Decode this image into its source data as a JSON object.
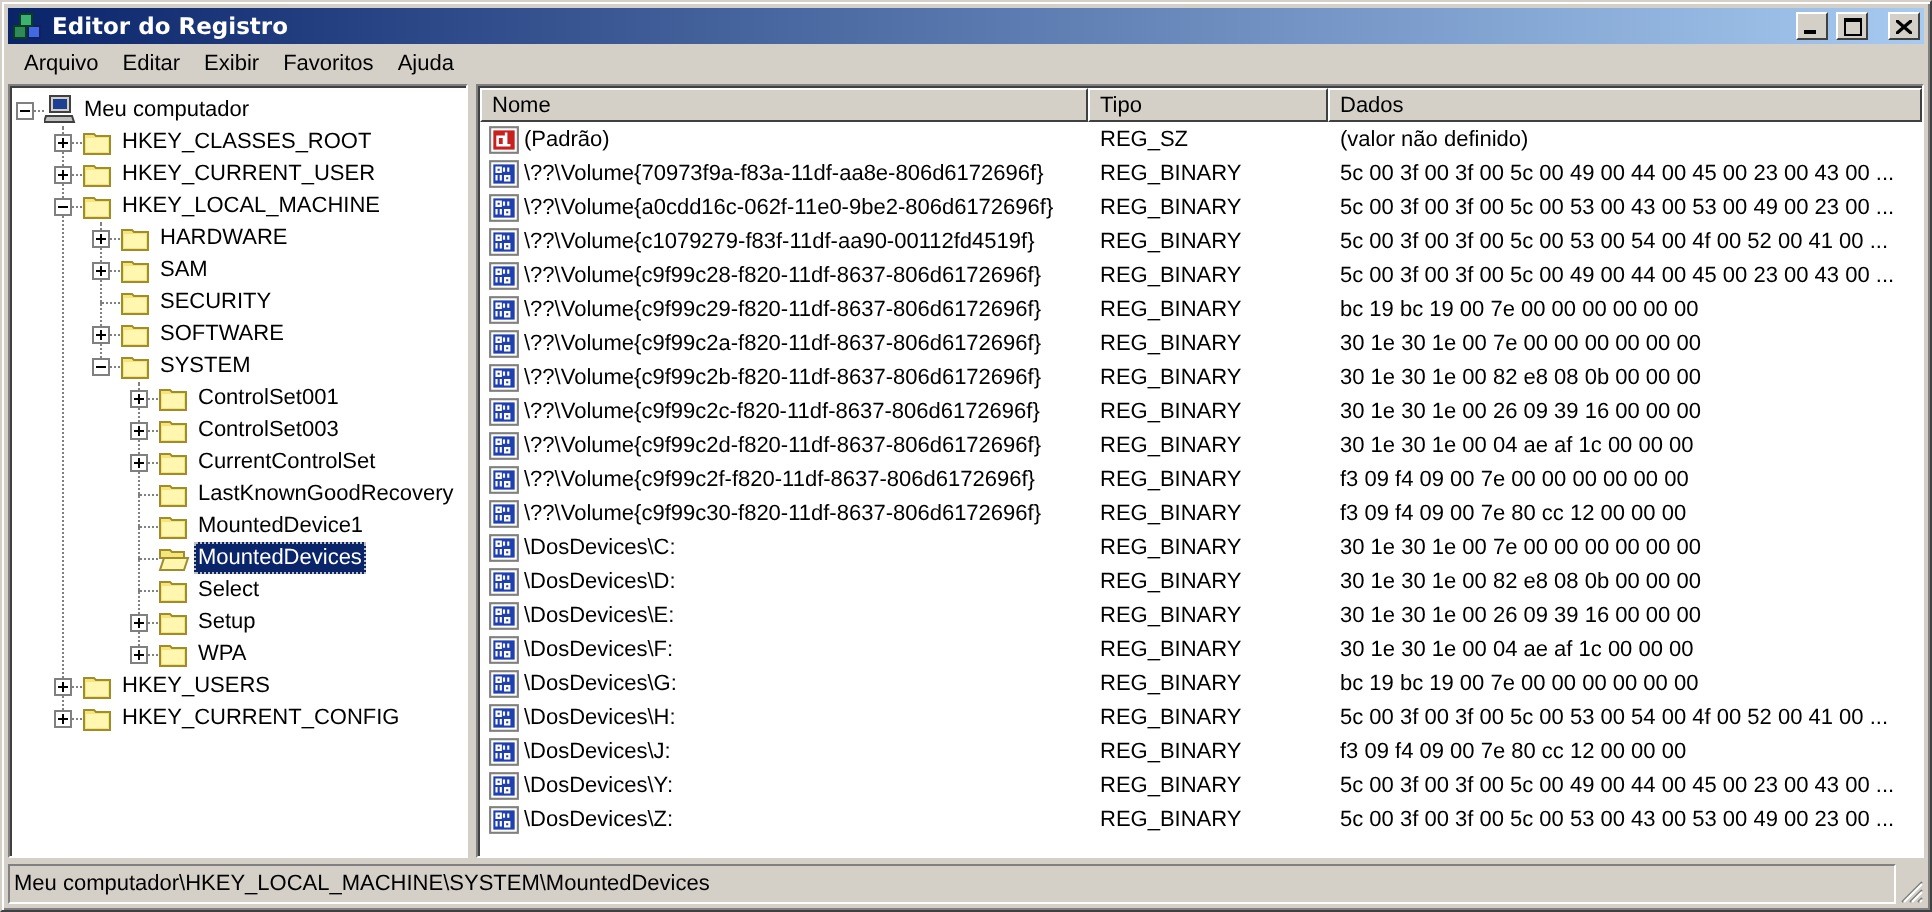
{
  "window": {
    "title": "Editor do Registro"
  },
  "menu": [
    "Arquivo",
    "Editar",
    "Exibir",
    "Favoritos",
    "Ajuda"
  ],
  "tree": {
    "root": {
      "label": "Meu computador",
      "expandable": true,
      "selected": false,
      "children": [
        {
          "label": "HKEY_CLASSES_ROOT",
          "expandable": true,
          "selected": false
        },
        {
          "label": "HKEY_CURRENT_USER",
          "expandable": true,
          "selected": false
        },
        {
          "label": "HKEY_LOCAL_MACHINE",
          "expandable": true,
          "selected": false,
          "children": [
            {
              "label": "HARDWARE",
              "expandable": true,
              "selected": false
            },
            {
              "label": "SAM",
              "expandable": true,
              "selected": false
            },
            {
              "label": "SECURITY",
              "expandable": false,
              "selected": false
            },
            {
              "label": "SOFTWARE",
              "expandable": true,
              "selected": false
            },
            {
              "label": "SYSTEM",
              "expandable": true,
              "selected": false,
              "children": [
                {
                  "label": "ControlSet001",
                  "expandable": true,
                  "selected": false
                },
                {
                  "label": "ControlSet003",
                  "expandable": true,
                  "selected": false
                },
                {
                  "label": "CurrentControlSet",
                  "expandable": true,
                  "selected": false
                },
                {
                  "label": "LastKnownGoodRecovery",
                  "expandable": false,
                  "selected": false
                },
                {
                  "label": "MountedDevice1",
                  "expandable": false,
                  "selected": false
                },
                {
                  "label": "MountedDevices",
                  "expandable": false,
                  "selected": true
                },
                {
                  "label": "Select",
                  "expandable": false,
                  "selected": false
                },
                {
                  "label": "Setup",
                  "expandable": true,
                  "selected": false
                },
                {
                  "label": "WPA",
                  "expandable": true,
                  "selected": false
                }
              ]
            }
          ]
        },
        {
          "label": "HKEY_USERS",
          "expandable": true,
          "selected": false
        },
        {
          "label": "HKEY_CURRENT_CONFIG",
          "expandable": true,
          "selected": false
        }
      ]
    }
  },
  "table": {
    "columns": [
      "Nome",
      "Tipo",
      "Dados"
    ],
    "rows": [
      {
        "kind": "string",
        "name": "(Padrão)",
        "type": "REG_SZ",
        "data": "(valor não definido)"
      },
      {
        "kind": "binary",
        "name": "\\??\\Volume{70973f9a-f83a-11df-aa8e-806d6172696f}",
        "type": "REG_BINARY",
        "data": "5c 00 3f 00 3f 00 5c 00 49 00 44 00 45 00 23 00 43 00 ..."
      },
      {
        "kind": "binary",
        "name": "\\??\\Volume{a0cdd16c-062f-11e0-9be2-806d6172696f}",
        "type": "REG_BINARY",
        "data": "5c 00 3f 00 3f 00 5c 00 53 00 43 00 53 00 49 00 23 00 ..."
      },
      {
        "kind": "binary",
        "name": "\\??\\Volume{c1079279-f83f-11df-aa90-00112fd4519f}",
        "type": "REG_BINARY",
        "data": "5c 00 3f 00 3f 00 5c 00 53 00 54 00 4f 00 52 00 41 00 ..."
      },
      {
        "kind": "binary",
        "name": "\\??\\Volume{c9f99c28-f820-11df-8637-806d6172696f}",
        "type": "REG_BINARY",
        "data": "5c 00 3f 00 3f 00 5c 00 49 00 44 00 45 00 23 00 43 00 ..."
      },
      {
        "kind": "binary",
        "name": "\\??\\Volume{c9f99c29-f820-11df-8637-806d6172696f}",
        "type": "REG_BINARY",
        "data": "bc 19 bc 19 00 7e 00 00 00 00 00 00"
      },
      {
        "kind": "binary",
        "name": "\\??\\Volume{c9f99c2a-f820-11df-8637-806d6172696f}",
        "type": "REG_BINARY",
        "data": "30 1e 30 1e 00 7e 00 00 00 00 00 00"
      },
      {
        "kind": "binary",
        "name": "\\??\\Volume{c9f99c2b-f820-11df-8637-806d6172696f}",
        "type": "REG_BINARY",
        "data": "30 1e 30 1e 00 82 e8 08 0b 00 00 00"
      },
      {
        "kind": "binary",
        "name": "\\??\\Volume{c9f99c2c-f820-11df-8637-806d6172696f}",
        "type": "REG_BINARY",
        "data": "30 1e 30 1e 00 26 09 39 16 00 00 00"
      },
      {
        "kind": "binary",
        "name": "\\??\\Volume{c9f99c2d-f820-11df-8637-806d6172696f}",
        "type": "REG_BINARY",
        "data": "30 1e 30 1e 00 04 ae af 1c 00 00 00"
      },
      {
        "kind": "binary",
        "name": "\\??\\Volume{c9f99c2f-f820-11df-8637-806d6172696f}",
        "type": "REG_BINARY",
        "data": "f3 09 f4 09 00 7e 00 00 00 00 00 00"
      },
      {
        "kind": "binary",
        "name": "\\??\\Volume{c9f99c30-f820-11df-8637-806d6172696f}",
        "type": "REG_BINARY",
        "data": "f3 09 f4 09 00 7e 80 cc 12 00 00 00"
      },
      {
        "kind": "binary",
        "name": "\\DosDevices\\C:",
        "type": "REG_BINARY",
        "data": "30 1e 30 1e 00 7e 00 00 00 00 00 00"
      },
      {
        "kind": "binary",
        "name": "\\DosDevices\\D:",
        "type": "REG_BINARY",
        "data": "30 1e 30 1e 00 82 e8 08 0b 00 00 00"
      },
      {
        "kind": "binary",
        "name": "\\DosDevices\\E:",
        "type": "REG_BINARY",
        "data": "30 1e 30 1e 00 26 09 39 16 00 00 00"
      },
      {
        "kind": "binary",
        "name": "\\DosDevices\\F:",
        "type": "REG_BINARY",
        "data": "30 1e 30 1e 00 04 ae af 1c 00 00 00"
      },
      {
        "kind": "binary",
        "name": "\\DosDevices\\G:",
        "type": "REG_BINARY",
        "data": "bc 19 bc 19 00 7e 00 00 00 00 00 00"
      },
      {
        "kind": "binary",
        "name": "\\DosDevices\\H:",
        "type": "REG_BINARY",
        "data": "5c 00 3f 00 3f 00 5c 00 53 00 54 00 4f 00 52 00 41 00 ..."
      },
      {
        "kind": "binary",
        "name": "\\DosDevices\\J:",
        "type": "REG_BINARY",
        "data": "f3 09 f4 09 00 7e 80 cc 12 00 00 00"
      },
      {
        "kind": "binary",
        "name": "\\DosDevices\\Y:",
        "type": "REG_BINARY",
        "data": "5c 00 3f 00 3f 00 5c 00 49 00 44 00 45 00 23 00 43 00 ..."
      },
      {
        "kind": "binary",
        "name": "\\DosDevices\\Z:",
        "type": "REG_BINARY",
        "data": "5c 00 3f 00 3f 00 5c 00 53 00 43 00 53 00 49 00 23 00 ..."
      }
    ]
  },
  "status_bar": "Meu computador\\HKEY_LOCAL_MACHINE\\SYSTEM\\MountedDevices"
}
